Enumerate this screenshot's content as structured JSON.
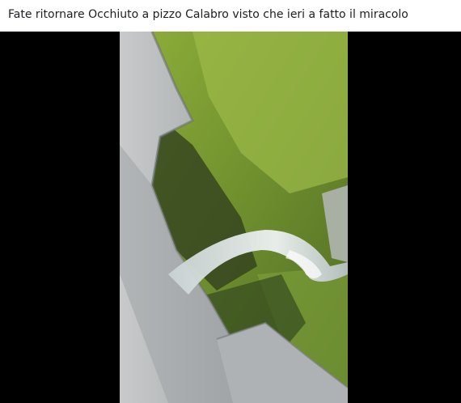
{
  "post": {
    "caption": "Fate ritornare Occhiuto a pizzo Calabro visto che ieri a fatto il miracolo"
  },
  "video": {
    "background_color": "#000000",
    "scene_colors": {
      "concrete": "#b9bcbe",
      "grass": "#6f8f2e",
      "shadow_grass": "#3d4a24",
      "water": "#dfe6e6"
    }
  }
}
